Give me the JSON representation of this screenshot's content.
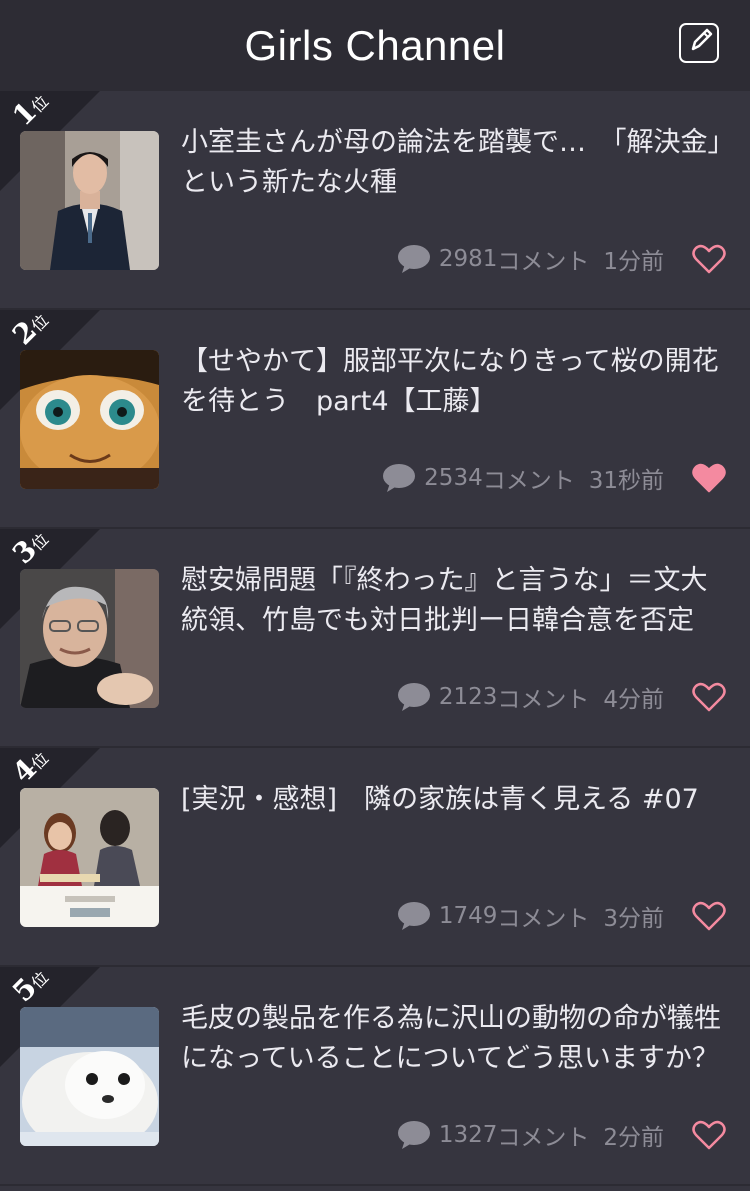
{
  "header": {
    "title": "Girls Channel",
    "compose_icon": "compose-icon"
  },
  "rank_suffix": "位",
  "colors": {
    "background": "#36353f",
    "header": "#2d2c34",
    "heart": "#f48aa0",
    "meta": "#8d8c96"
  },
  "items": [
    {
      "rank": "1",
      "title": "小室圭さんが母の論法を踏襲で…　「解決金」という新たな火種",
      "comments": "2981",
      "comment_label": "コメント",
      "time": "1分前",
      "liked": false,
      "thumbnail_icon": "man-in-suit-photo"
    },
    {
      "rank": "2",
      "title": "【せやかて】服部平次になりきって桜の開花を待とう　part4【工藤】",
      "comments": "2534",
      "comment_label": "コメント",
      "time": "31秒前",
      "liked": true,
      "thumbnail_icon": "anime-character-photo"
    },
    {
      "rank": "3",
      "title": "慰安婦問題「『終わった』と言うな」＝文大統領、竹島でも対日批判ー日韓合意を否定",
      "comments": "2123",
      "comment_label": "コメント",
      "time": "4分前",
      "liked": false,
      "thumbnail_icon": "president-photo"
    },
    {
      "rank": "4",
      "title": "[実況・感想]　隣の家族は青く見える #07",
      "comments": "1749",
      "comment_label": "コメント",
      "time": "3分前",
      "liked": false,
      "thumbnail_icon": "drama-still-photo"
    },
    {
      "rank": "5",
      "title": "毛皮の製品を作る為に沢山の動物の命が犠牲になっていることについてどう思いますか？",
      "comments": "1327",
      "comment_label": "コメント",
      "time": "2分前",
      "liked": false,
      "thumbnail_icon": "seal-pup-photo"
    }
  ]
}
